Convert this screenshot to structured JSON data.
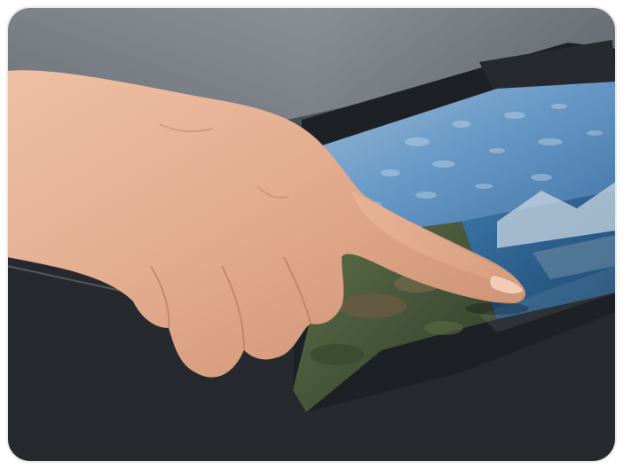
{
  "image": {
    "subject": "hand-touching-touchscreen-photo",
    "bezel_text": "",
    "colors": {
      "border": "#ffffff",
      "device_body": "#3a3f45",
      "device_dark": "#1e2226",
      "screen_sky": "#5e8fbf",
      "screen_water": "#2f6a98",
      "screen_rocks": "#4a5a3c",
      "skin": "#e3ae92"
    }
  }
}
